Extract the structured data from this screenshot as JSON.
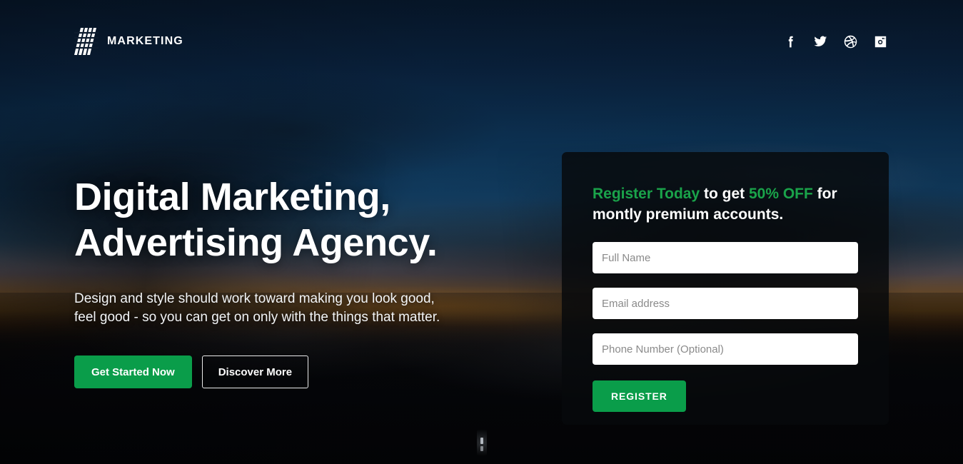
{
  "brand": {
    "name": "MARKETING",
    "logo_icon": "diagonal-slashes-logo"
  },
  "social": [
    {
      "name": "facebook",
      "icon": "facebook-icon",
      "label": "Facebook"
    },
    {
      "name": "twitter",
      "icon": "twitter-icon",
      "label": "Twitter"
    },
    {
      "name": "dribbble",
      "icon": "dribbble-icon",
      "label": "Dribbble"
    },
    {
      "name": "instagram",
      "icon": "instagram-icon",
      "label": "Instagram"
    }
  ],
  "hero": {
    "headline_line1": "Digital Marketing,",
    "headline_line2": "Advertising Agency.",
    "subhead_line1": "Design and style should work toward making you look good,",
    "subhead_line2": "feel good - so you can get on only with the things that matter.",
    "primary_cta": "Get Started Now",
    "secondary_cta": "Discover More"
  },
  "register_panel": {
    "title_accent_1": "Register Today",
    "title_mid": " to get ",
    "title_accent_2": "50% OFF",
    "title_tail": " for montly premium accounts.",
    "fields": {
      "full_name_value": "",
      "full_name_placeholder": "Full Name",
      "email_value": "",
      "email_placeholder": "Email address",
      "phone_value": "",
      "phone_placeholder": "Phone Number (Optional)"
    },
    "submit_label": "REGISTER"
  },
  "scroll_indicator": {
    "icon": "scroll-down-indicator"
  },
  "colors": {
    "brand_green": "#0a9d4a",
    "accent_green": "#1aa34a",
    "panel_bg": "rgba(7,9,12,0.84)",
    "text_white": "#ffffff",
    "placeholder_grey": "#8a8a8a",
    "sky_dark_navy": "#07182c",
    "sunset_orange": "#d98d2a"
  }
}
